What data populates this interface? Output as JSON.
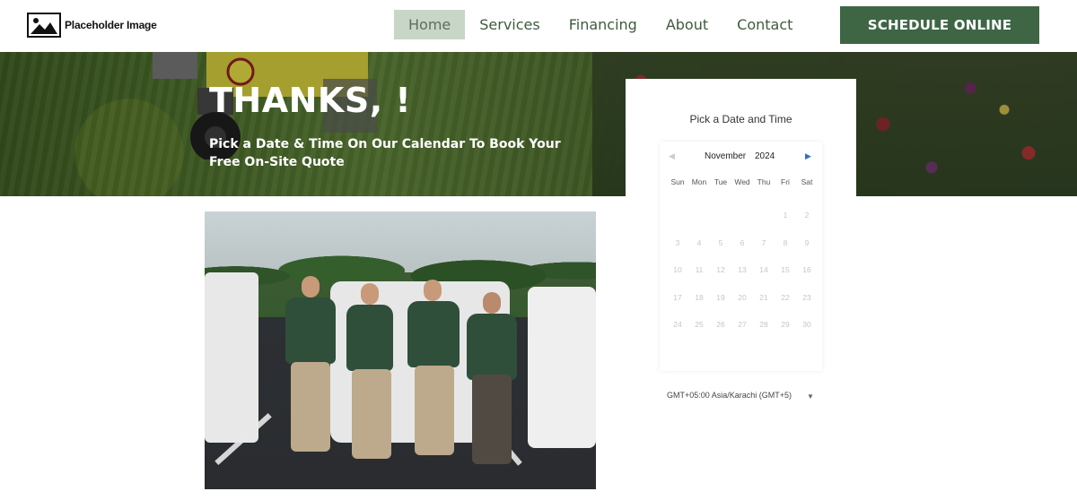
{
  "header": {
    "logo_text": "Placeholder Image",
    "nav": [
      {
        "label": "Home",
        "active": true
      },
      {
        "label": "Services",
        "active": false
      },
      {
        "label": "Financing",
        "active": false
      },
      {
        "label": "About",
        "active": false
      },
      {
        "label": "Contact",
        "active": false
      }
    ],
    "cta_label": "SCHEDULE ONLINE",
    "cta_color": "#3e6645"
  },
  "hero": {
    "title": "THANKS, !",
    "subtitle": "Pick a Date & Time On Our Calendar To Book Your Free On-Site Quote"
  },
  "booking": {
    "title": "Pick a Date and Time",
    "calendar": {
      "month": "November",
      "year": "2024",
      "prev_icon": "chevron-left-icon",
      "next_icon": "chevron-right-icon",
      "days_of_week": [
        "Sun",
        "Mon",
        "Tue",
        "Wed",
        "Thu",
        "Fri",
        "Sat"
      ],
      "days": [
        "",
        "",
        "",
        "",
        "",
        "1",
        "2",
        "3",
        "4",
        "5",
        "6",
        "7",
        "8",
        "9",
        "10",
        "11",
        "12",
        "13",
        "14",
        "15",
        "16",
        "17",
        "18",
        "19",
        "20",
        "21",
        "22",
        "23",
        "24",
        "25",
        "26",
        "27",
        "28",
        "29",
        "30"
      ]
    },
    "timezone": "GMT+05:00 Asia/Karachi (GMT+5)",
    "accent_color": "#2d6fd0"
  }
}
